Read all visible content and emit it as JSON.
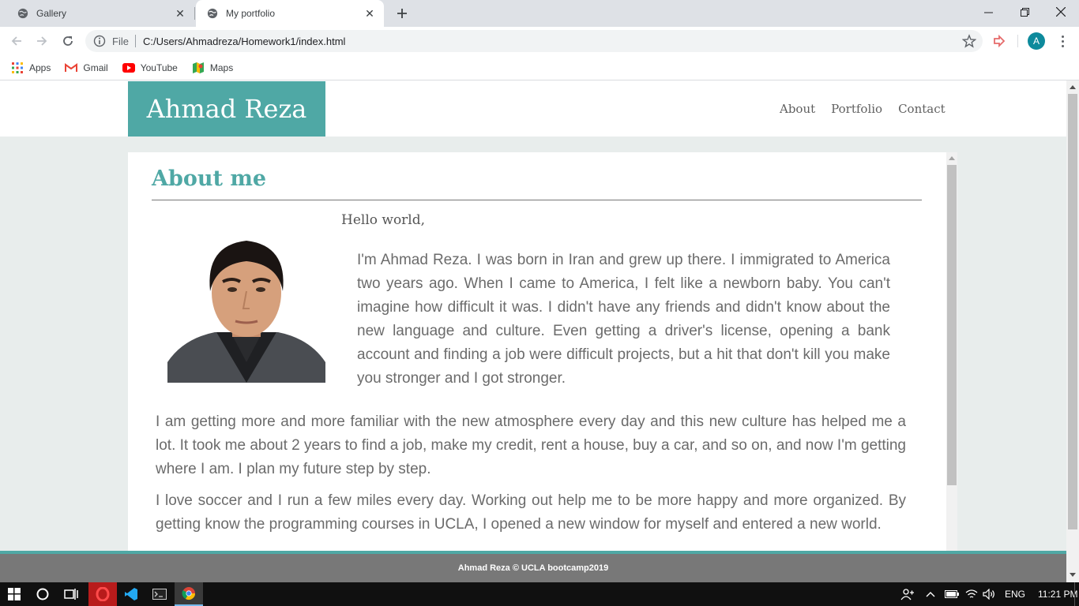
{
  "browser": {
    "tabs": [
      {
        "title": "Gallery",
        "active": false
      },
      {
        "title": "My portfolio",
        "active": true
      }
    ],
    "address": {
      "scheme_label": "File",
      "url": "C:/Users/Ahmadreza/Homework1/index.html"
    },
    "profile_initial": "A",
    "bookmarks": [
      {
        "label": "Apps",
        "icon": "apps-grid-icon"
      },
      {
        "label": "Gmail",
        "icon": "gmail-icon"
      },
      {
        "label": "YouTube",
        "icon": "youtube-icon"
      },
      {
        "label": "Maps",
        "icon": "maps-icon"
      }
    ]
  },
  "site": {
    "brand": "Ahmad Reza",
    "nav": [
      "About",
      "Portfolio",
      "Contact"
    ],
    "section_title": "About me",
    "greeting": "Hello world,",
    "paragraphs": [
      "I'm Ahmad Reza. I was born in Iran and grew up there. I immigrated to America two years ago. When I came to America, I felt like a newborn baby. You can't imagine how difficult it was. I didn't have any friends and didn't know about the new language and culture. Even getting a driver's license, opening a bank account and finding a job were difficult projects, but a hit that don't kill you make you stronger and I got stronger.",
      "I am getting more and more familiar with the new atmosphere every day and this new culture has helped me a lot. It took me about 2 years to find a job, make my credit, rent a house, buy a car, and so on, and now I'm getting where I am. I plan my future step by step.",
      "I love soccer and I run a few miles every day. Working out help me to be more happy and more organized. By getting know the programming courses in UCLA, I opened a new window for myself and entered a new world."
    ],
    "footer": "Ahmad Reza © UCLA bootcamp2019",
    "colors": {
      "accent": "#4fa8a5",
      "footer_bg": "#787878",
      "page_bg": "#e8edec"
    }
  },
  "taskbar": {
    "language": "ENG",
    "time": "11:21 PM"
  }
}
